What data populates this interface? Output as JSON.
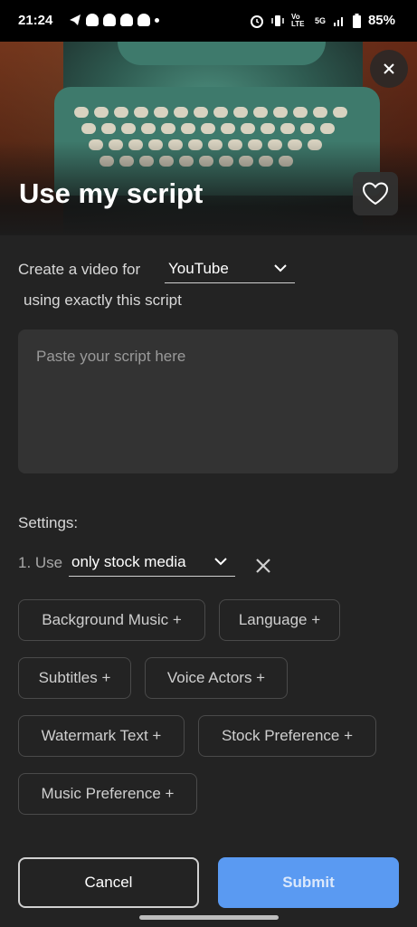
{
  "status_bar": {
    "time": "21:24",
    "battery": "85%",
    "network": "5G",
    "volte": "Vo LTE"
  },
  "header": {
    "title": "Use my script",
    "close_icon": "close-icon",
    "favorite_icon": "heart-icon"
  },
  "form": {
    "create_prefix": "Create a video for",
    "platform_value": "YouTube",
    "using_text": "using exactly this script",
    "script_placeholder": "Paste your script here"
  },
  "settings": {
    "label": "Settings:",
    "item_1_prefix": "1. Use",
    "item_1_value": "only stock media",
    "chips": [
      "Background Music +",
      "Language +",
      "Subtitles +",
      "Voice Actors +",
      "Watermark Text +",
      "Stock Preference +",
      "Music Preference +"
    ]
  },
  "actions": {
    "cancel": "Cancel",
    "submit": "Submit"
  },
  "colors": {
    "background": "#232323",
    "accent": "#5a9af2",
    "field": "#333333"
  }
}
